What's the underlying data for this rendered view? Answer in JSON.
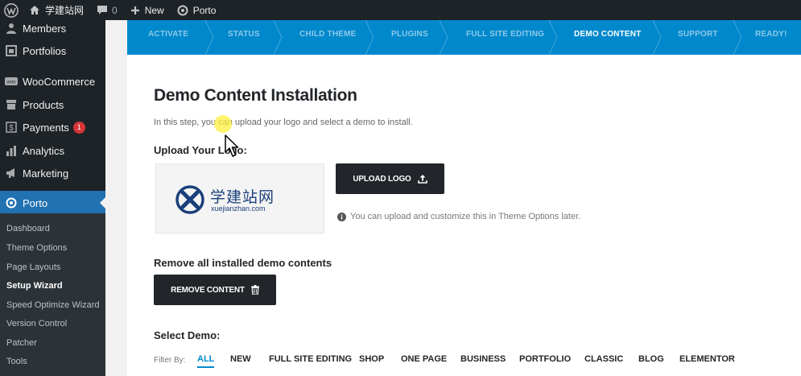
{
  "adminbar": {
    "site_name": "学建站网",
    "comment_count": "0",
    "new_label": "New",
    "porto_label": "Porto"
  },
  "sidebar": {
    "items": [
      {
        "label": "Members",
        "icon": "members-icon"
      },
      {
        "label": "Portfolios",
        "icon": "portfolio-icon"
      },
      {
        "label": "WooCommerce",
        "icon": "woo-icon"
      },
      {
        "label": "Products",
        "icon": "archive-icon"
      },
      {
        "label": "Payments",
        "icon": "dollar-icon",
        "badge": "1"
      },
      {
        "label": "Analytics",
        "icon": "chart-bar-icon"
      },
      {
        "label": "Marketing",
        "icon": "megaphone-icon"
      },
      {
        "label": "Porto",
        "icon": "porto-icon"
      }
    ],
    "submenu": [
      {
        "label": "Dashboard"
      },
      {
        "label": "Theme Options"
      },
      {
        "label": "Page Layouts"
      },
      {
        "label": "Setup Wizard"
      },
      {
        "label": "Speed Optimize Wizard"
      },
      {
        "label": "Version Control"
      },
      {
        "label": "Patcher"
      },
      {
        "label": "Tools"
      }
    ]
  },
  "wizard": {
    "steps": [
      {
        "label": "ACTIVATE"
      },
      {
        "label": "STATUS"
      },
      {
        "label": "CHILD THEME"
      },
      {
        "label": "PLUGINS"
      },
      {
        "label": "FULL SITE EDITING"
      },
      {
        "label": "DEMO CONTENT"
      },
      {
        "label": "SUPPORT"
      },
      {
        "label": "READY!"
      }
    ],
    "active_step": "DEMO CONTENT",
    "title": "Demo Content Installation",
    "intro": "In this step, you can upload your logo and select a demo to install.",
    "upload_heading": "Upload Your Logo:",
    "logo": {
      "text_cn": "学建站网",
      "text_url": "xuejianzhan.com"
    },
    "upload_button": "UPLOAD LOGO",
    "upload_note": "You can upload and customize this in Theme Options later.",
    "remove_heading": "Remove all installed demo contents",
    "remove_button": "REMOVE CONTENT",
    "select_heading": "Select Demo:",
    "filter_label": "Filter By:",
    "filters": [
      {
        "label": "ALL"
      },
      {
        "label": "NEW"
      },
      {
        "label": "FULL SITE EDITING"
      },
      {
        "label": "SHOP"
      },
      {
        "label": "ONE PAGE"
      },
      {
        "label": "BUSINESS"
      },
      {
        "label": "PORTFOLIO"
      },
      {
        "label": "CLASSIC"
      },
      {
        "label": "BLOG"
      },
      {
        "label": "ELEMENTOR"
      }
    ],
    "active_filter": "ALL"
  },
  "colors": {
    "accent": "#0088cc",
    "admin_dark": "#1d2327",
    "wp_blue": "#2271b1",
    "badge_red": "#d63638",
    "button_dark": "#222529"
  }
}
